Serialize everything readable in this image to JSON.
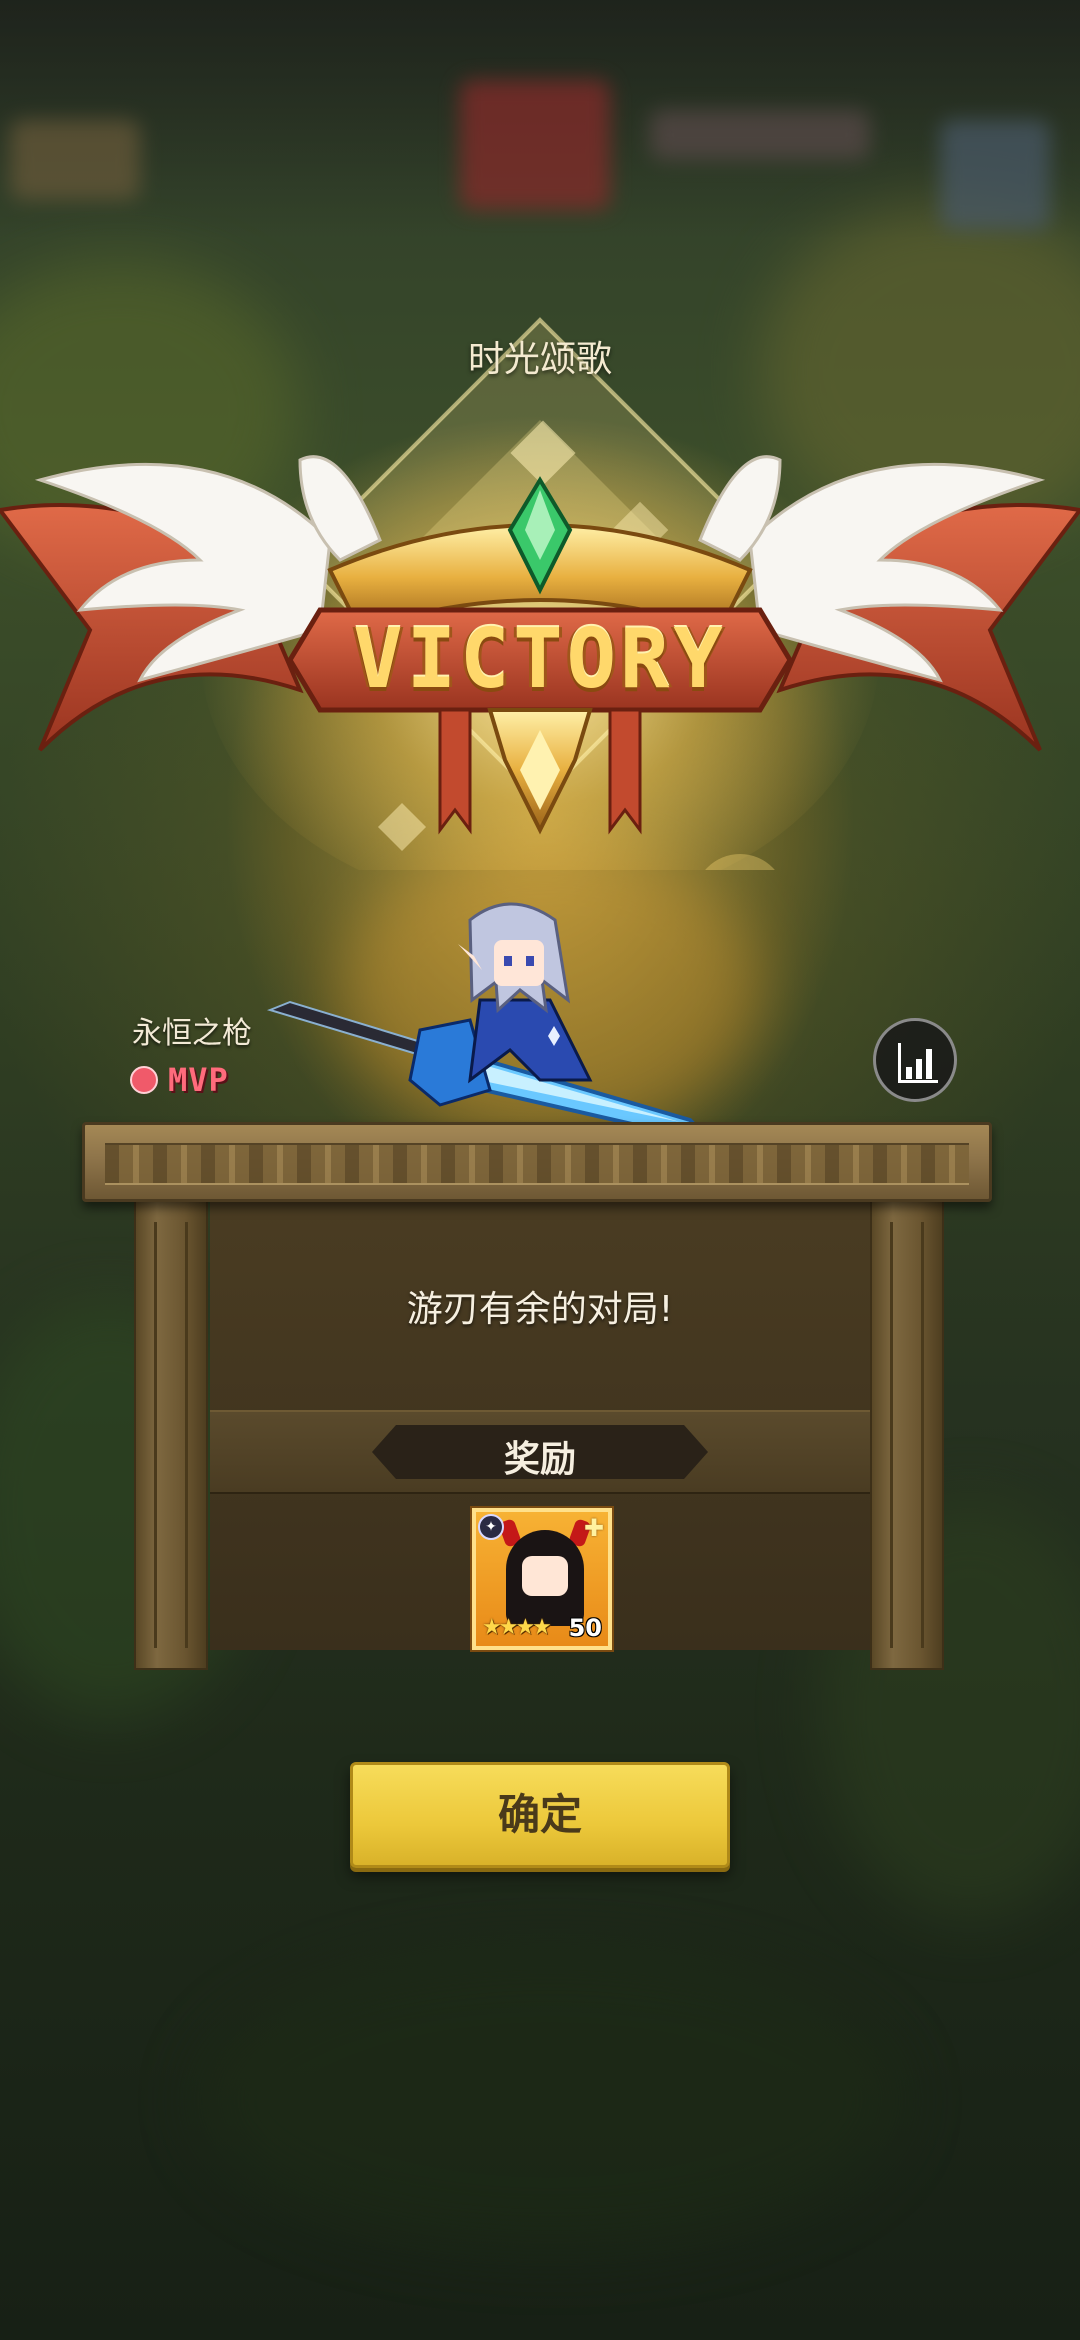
{
  "header": {
    "stage_name": "时光颂歌",
    "result_banner": "VICTORY"
  },
  "player": {
    "name": "永恒之枪",
    "mvp_label": "MVP"
  },
  "result": {
    "message": "游刃有余的对局!",
    "reward_title": "奖励",
    "reward_items": [
      {
        "icon": "dark-haired-hero-portrait",
        "stars": "★★★★",
        "count": "50"
      }
    ]
  },
  "actions": {
    "confirm_label": "确定"
  },
  "colors": {
    "accent_gold": "#ffd86b",
    "confirm_button": "#ecc83a",
    "mvp_red": "#f05a6a"
  }
}
